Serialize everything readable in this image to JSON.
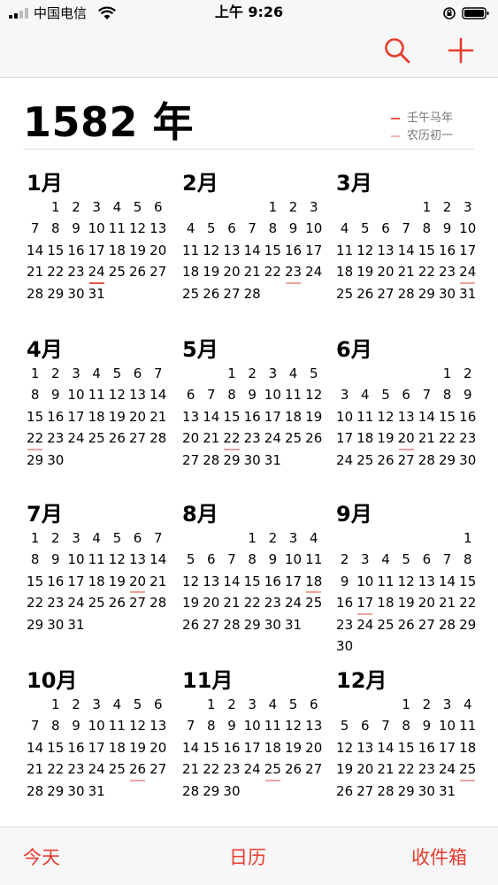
{
  "status_bar": {
    "carrier": "中国电信",
    "time": "上午 9:26"
  },
  "nav": {
    "search_icon": "search-icon",
    "add_icon": "plus-icon",
    "accent_color": "#e63b2e"
  },
  "year": {
    "title": "1582 年"
  },
  "legend": {
    "items": [
      {
        "label": "壬午马年",
        "color": "#e3564a"
      },
      {
        "label": "农历初一",
        "color": "#f2b5b0"
      }
    ]
  },
  "months": [
    {
      "name": "1月",
      "offset": 1,
      "days": 31,
      "marked": [
        24
      ]
    },
    {
      "name": "2月",
      "offset": 4,
      "days": 28,
      "marked": [
        23
      ]
    },
    {
      "name": "3月",
      "offset": 4,
      "days": 31,
      "marked": [
        24
      ]
    },
    {
      "name": "4月",
      "offset": 0,
      "days": 30,
      "marked": [
        22
      ]
    },
    {
      "name": "5月",
      "offset": 2,
      "days": 31,
      "marked": [
        22
      ]
    },
    {
      "name": "6月",
      "offset": 5,
      "days": 30,
      "marked": [
        20
      ]
    },
    {
      "name": "7月",
      "offset": 0,
      "days": 31,
      "marked": [
        20
      ]
    },
    {
      "name": "8月",
      "offset": 3,
      "days": 31,
      "marked": [
        18
      ]
    },
    {
      "name": "9月",
      "offset": 6,
      "days": 30,
      "marked": [
        17
      ]
    },
    {
      "name": "10月",
      "offset": 1,
      "days": 31,
      "marked": [
        26
      ]
    },
    {
      "name": "11月",
      "offset": 1,
      "days": 30,
      "marked": [
        25
      ]
    },
    {
      "name": "12月",
      "offset": 3,
      "days": 31,
      "marked": [
        25
      ]
    }
  ],
  "tabbar": {
    "today": "今天",
    "calendars": "日历",
    "inbox": "收件箱"
  }
}
